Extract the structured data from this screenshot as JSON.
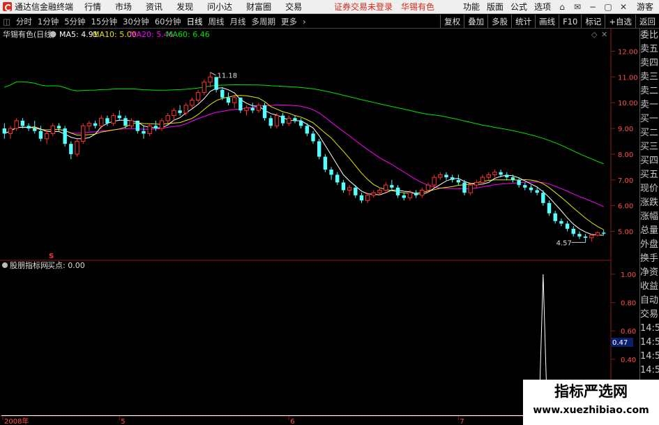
{
  "menubar": {
    "app_name": "通达信金融终端",
    "items": [
      "行情",
      "市场",
      "资讯",
      "发现",
      "问小达",
      "财富圈",
      "交易"
    ],
    "warning": "证券交易未登录",
    "stock": "华锡有色",
    "right_items": [
      "功能",
      "版面",
      "公式",
      "选项"
    ],
    "guest": "游客"
  },
  "toolbar": {
    "periods": [
      "分时",
      "1分钟",
      "5分钟",
      "15分钟",
      "30分钟",
      "60分钟",
      "日线",
      "周线",
      "月线",
      "多周期",
      "更多"
    ],
    "active": "日线",
    "right": [
      "复权",
      "叠加",
      "多股",
      "统计",
      "画线",
      "F10",
      "标记",
      "+自选",
      "返回"
    ]
  },
  "main_chart": {
    "stock_label": "华锡有色(日线)",
    "ma5": "MA5: 4.91",
    "ma10": "MA10: 5.00",
    "ma20": "MA20: 5.46",
    "ma60": "MA60: 6.46",
    "high_label": "11.18",
    "low_label": "4.57",
    "y_ticks": [
      "12.00",
      "11.00",
      "10.00",
      "9.00",
      "8.00",
      "7.00",
      "6.00",
      "5.00"
    ],
    "signal_marker": "S",
    "colors": {
      "up": "#ff3232",
      "down": "#54ffff",
      "ma5": "#ffffff",
      "ma10": "#e6e600",
      "ma20": "#ff00ff",
      "ma60": "#00e600"
    }
  },
  "sub_chart": {
    "indicator_label": "股朋指标网",
    "value_label": "买点: 0.00",
    "y_ticks": [
      "1.00",
      "0.80",
      "0.60",
      "0.40",
      "0.20"
    ],
    "current_value": "0.47",
    "spike_value": 1.0
  },
  "x_axis": {
    "labels": [
      "2008年",
      "5",
      "6",
      "7",
      "8"
    ]
  },
  "right_panel": {
    "items": [
      "委比",
      "卖五",
      "卖四",
      "卖三",
      "卖二",
      "卖一",
      "买一",
      "买二",
      "买三",
      "买四",
      "买五",
      "现价",
      "涨跌",
      "涨幅",
      "总量",
      "外盘",
      "换手",
      "净资",
      "收益",
      "自动",
      "交易",
      "14:56",
      "14:56",
      "14:56",
      "14:56",
      "14:56",
      "14:56",
      "14:56",
      "14:56"
    ]
  },
  "watermark": {
    "line1": "指标严选网",
    "line2": "www.xuezhibiao.com"
  },
  "chart_data": {
    "type": "candlestick",
    "ylim": [
      4.2,
      12.5
    ],
    "candles": [
      [
        9.0,
        9.2,
        8.6,
        8.8
      ],
      [
        8.8,
        9.1,
        8.6,
        9.0
      ],
      [
        9.0,
        9.4,
        8.9,
        9.3
      ],
      [
        9.3,
        9.4,
        9.0,
        9.1
      ],
      [
        9.1,
        9.2,
        8.9,
        9.0
      ],
      [
        9.0,
        9.3,
        8.8,
        8.9
      ],
      [
        8.9,
        9.1,
        8.5,
        8.6
      ],
      [
        8.6,
        8.9,
        8.4,
        8.8
      ],
      [
        8.8,
        9.2,
        8.7,
        9.1
      ],
      [
        9.1,
        9.2,
        8.9,
        9.0
      ],
      [
        9.0,
        9.1,
        8.3,
        8.4
      ],
      [
        8.4,
        8.5,
        7.8,
        8.0
      ],
      [
        8.0,
        8.6,
        7.9,
        8.5
      ],
      [
        8.5,
        9.2,
        8.4,
        9.1
      ],
      [
        9.1,
        9.3,
        8.9,
        9.2
      ],
      [
        9.2,
        9.3,
        9.0,
        9.1
      ],
      [
        9.1,
        9.5,
        9.0,
        9.4
      ],
      [
        9.4,
        9.5,
        9.1,
        9.2
      ],
      [
        9.2,
        9.6,
        9.1,
        9.5
      ],
      [
        9.5,
        9.7,
        9.3,
        9.4
      ],
      [
        9.4,
        9.5,
        9.0,
        9.1
      ],
      [
        9.1,
        9.4,
        9.0,
        9.3
      ],
      [
        9.3,
        9.3,
        8.8,
        8.9
      ],
      [
        8.9,
        9.1,
        8.6,
        8.8
      ],
      [
        8.8,
        9.2,
        8.7,
        9.1
      ],
      [
        9.1,
        9.3,
        8.9,
        9.0
      ],
      [
        9.0,
        9.4,
        8.9,
        9.3
      ],
      [
        9.3,
        9.6,
        9.2,
        9.5
      ],
      [
        9.5,
        9.8,
        9.3,
        9.7
      ],
      [
        9.7,
        9.9,
        9.5,
        9.6
      ],
      [
        9.6,
        10.0,
        9.5,
        9.9
      ],
      [
        9.9,
        10.2,
        9.8,
        10.1
      ],
      [
        10.1,
        10.5,
        10.0,
        10.4
      ],
      [
        10.4,
        10.9,
        10.3,
        10.8
      ],
      [
        10.8,
        11.18,
        10.6,
        11.0
      ],
      [
        11.0,
        11.0,
        10.4,
        10.5
      ],
      [
        10.5,
        10.6,
        10.1,
        10.2
      ],
      [
        10.2,
        10.4,
        9.9,
        10.0
      ],
      [
        10.0,
        10.3,
        9.8,
        10.2
      ],
      [
        10.2,
        10.2,
        9.6,
        9.7
      ],
      [
        9.7,
        9.9,
        9.5,
        9.8
      ],
      [
        9.8,
        10.0,
        9.6,
        9.7
      ],
      [
        9.7,
        10.0,
        9.6,
        9.9
      ],
      [
        9.9,
        10.0,
        9.3,
        9.4
      ],
      [
        9.4,
        9.5,
        9.0,
        9.1
      ],
      [
        9.1,
        9.6,
        9.0,
        9.5
      ],
      [
        9.5,
        9.6,
        9.1,
        9.2
      ],
      [
        9.2,
        9.5,
        9.1,
        9.4
      ],
      [
        9.4,
        9.5,
        9.2,
        9.3
      ],
      [
        9.3,
        9.4,
        9.0,
        9.1
      ],
      [
        9.1,
        9.2,
        8.7,
        8.8
      ],
      [
        8.8,
        8.9,
        8.4,
        8.5
      ],
      [
        8.5,
        8.6,
        7.8,
        7.9
      ],
      [
        7.9,
        8.0,
        7.3,
        7.4
      ],
      [
        7.4,
        7.5,
        7.0,
        7.2
      ],
      [
        7.2,
        7.3,
        6.8,
        6.9
      ],
      [
        6.9,
        7.0,
        6.5,
        6.6
      ],
      [
        6.6,
        6.8,
        6.4,
        6.7
      ],
      [
        6.7,
        6.8,
        6.3,
        6.4
      ],
      [
        6.4,
        6.5,
        6.1,
        6.2
      ],
      [
        6.2,
        6.5,
        6.1,
        6.4
      ],
      [
        6.4,
        6.6,
        6.3,
        6.5
      ],
      [
        6.5,
        6.7,
        6.4,
        6.6
      ],
      [
        6.6,
        6.9,
        6.5,
        6.8
      ],
      [
        6.8,
        7.0,
        6.6,
        6.7
      ],
      [
        6.7,
        6.8,
        6.3,
        6.4
      ],
      [
        6.4,
        6.5,
        6.2,
        6.3
      ],
      [
        6.3,
        6.6,
        6.2,
        6.5
      ],
      [
        6.5,
        6.6,
        6.3,
        6.4
      ],
      [
        6.4,
        6.7,
        6.3,
        6.6
      ],
      [
        6.6,
        6.9,
        6.5,
        6.8
      ],
      [
        6.8,
        7.2,
        6.7,
        7.1
      ],
      [
        7.1,
        7.3,
        7.0,
        7.2
      ],
      [
        7.2,
        7.3,
        7.0,
        7.1
      ],
      [
        7.1,
        7.2,
        6.9,
        7.0
      ],
      [
        7.0,
        7.2,
        6.8,
        6.9
      ],
      [
        6.9,
        7.0,
        6.4,
        6.5
      ],
      [
        6.5,
        6.9,
        6.4,
        6.8
      ],
      [
        6.8,
        7.0,
        6.7,
        6.9
      ],
      [
        6.9,
        7.2,
        6.8,
        7.1
      ],
      [
        7.1,
        7.3,
        7.0,
        7.2
      ],
      [
        7.2,
        7.4,
        7.1,
        7.3
      ],
      [
        7.3,
        7.4,
        7.1,
        7.2
      ],
      [
        7.2,
        7.3,
        7.0,
        7.1
      ],
      [
        7.1,
        7.2,
        6.9,
        7.0
      ],
      [
        7.0,
        7.1,
        6.7,
        6.8
      ],
      [
        6.8,
        6.9,
        6.6,
        6.7
      ],
      [
        6.7,
        6.8,
        6.5,
        6.6
      ],
      [
        6.6,
        6.7,
        6.4,
        6.5
      ],
      [
        6.5,
        6.6,
        6.0,
        6.1
      ],
      [
        6.1,
        6.2,
        5.6,
        5.7
      ],
      [
        5.7,
        5.8,
        5.3,
        5.4
      ],
      [
        5.4,
        5.5,
        5.2,
        5.3
      ],
      [
        5.3,
        5.4,
        5.0,
        5.1
      ],
      [
        5.1,
        5.2,
        4.8,
        4.9
      ],
      [
        4.9,
        5.0,
        4.7,
        4.8
      ],
      [
        4.8,
        4.9,
        4.57,
        4.75
      ],
      [
        4.75,
        4.9,
        4.6,
        4.85
      ],
      [
        4.85,
        5.0,
        4.8,
        4.95
      ],
      [
        4.95,
        5.05,
        4.85,
        4.91
      ]
    ],
    "sub_signal_index": 89
  }
}
